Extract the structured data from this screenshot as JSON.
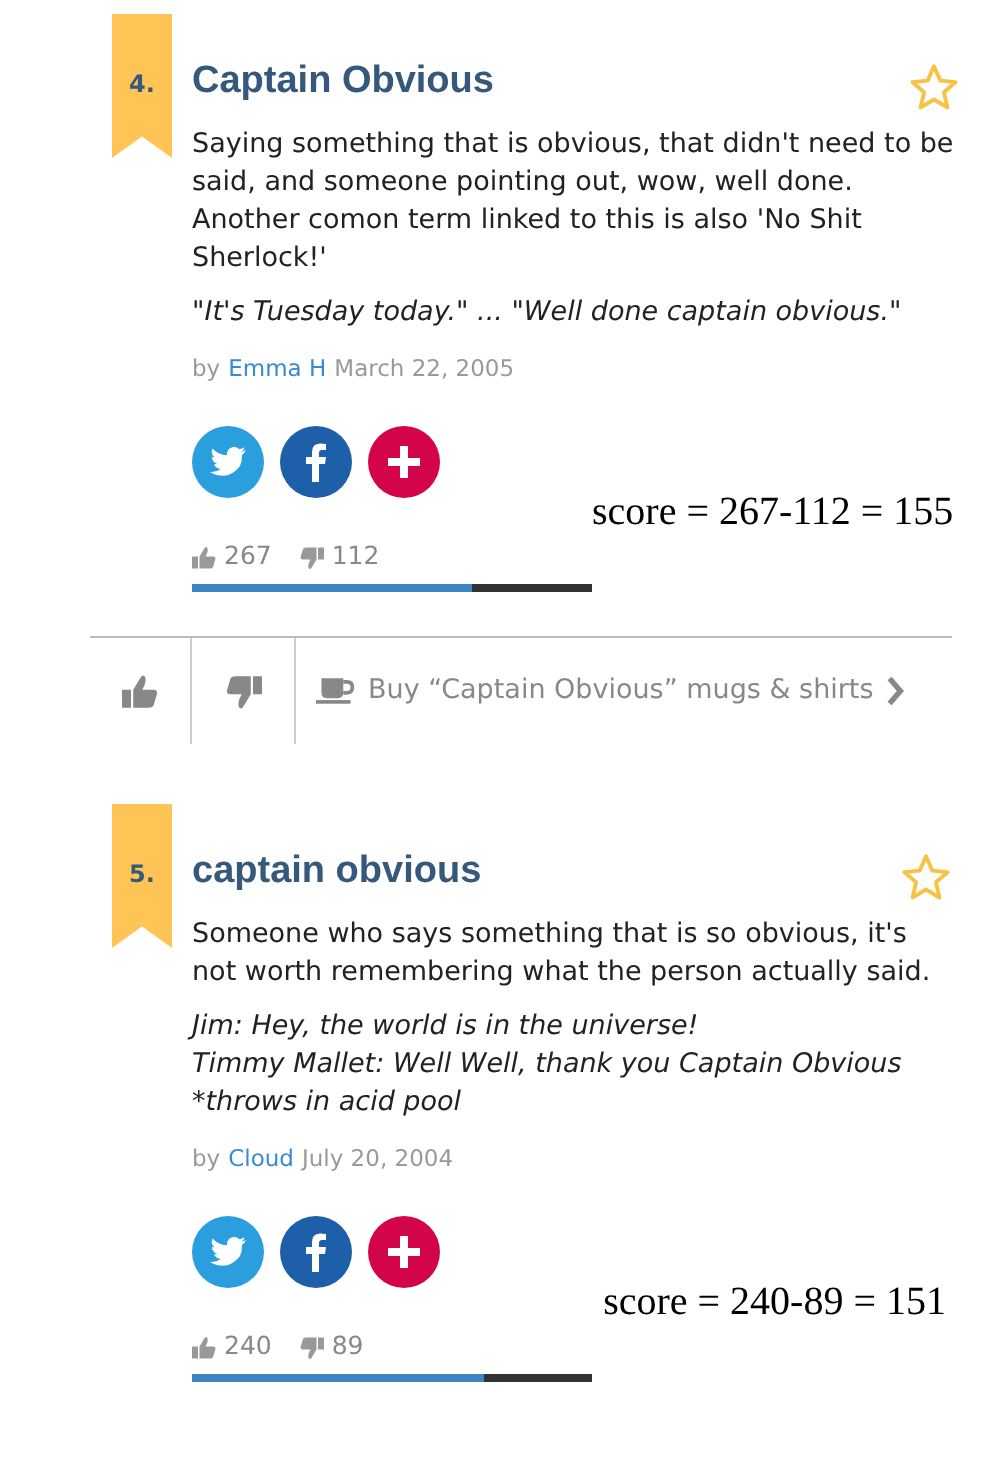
{
  "entries": [
    {
      "rank": "4.",
      "title": "Captain Obvious",
      "favorited": false,
      "meaning": "Saying something that is obvious, that didn't need to be said, and someone pointing out, wow, well done. Another comon term linked to this is also 'No Shit Sherlock!'",
      "example": [
        "\"It's Tuesday today.\" ... \"Well done captain obvious.\""
      ],
      "by": "by",
      "author": "Emma H",
      "date": "March 22, 2005",
      "score_note": "score = 267-112 = 155",
      "upvotes": "267",
      "downvotes": "112",
      "level": 0.7
    },
    {
      "rank": "5.",
      "title": "captain obvious",
      "favorited": false,
      "meaning": "Someone who says something that is so obvious, it's not worth remembering what the person actually said.",
      "example": [
        "Jim: Hey, the world is in the universe!",
        "Timmy Mallet: Well Well, thank you Captain Obvious *throws in acid pool"
      ],
      "by": "by",
      "author": "Cloud",
      "date": "July 20, 2004",
      "score_note": "score = 240-89 = 151",
      "upvotes": "240",
      "downvotes": "89",
      "level": 0.73
    }
  ],
  "action_bar": {
    "shop_link": "Buy “Captain Obvious” mugs & shirts"
  }
}
